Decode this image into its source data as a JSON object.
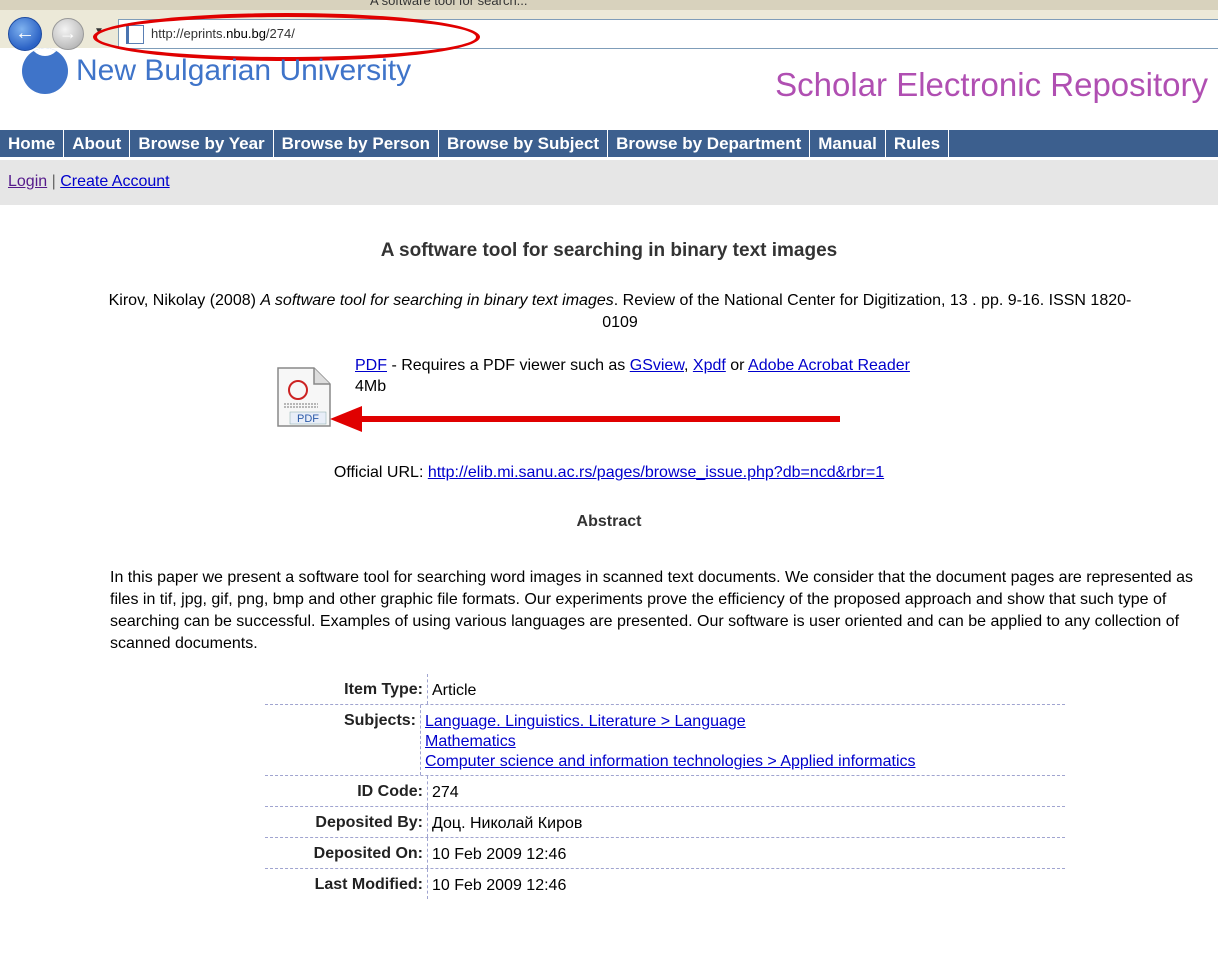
{
  "browser": {
    "url_prefix": "http://eprints.",
    "url_host": "nbu.bg",
    "url_suffix": "/274/",
    "tab_title": "A software tool for search..."
  },
  "site": {
    "university_name": "New Bulgarian University",
    "repository_name": "Scholar Electronic Repository"
  },
  "nav": [
    {
      "label": "Home"
    },
    {
      "label": "About"
    },
    {
      "label": "Browse by Year"
    },
    {
      "label": "Browse by Person"
    },
    {
      "label": "Browse by Subject"
    },
    {
      "label": "Browse by Department"
    },
    {
      "label": "Manual"
    },
    {
      "label": "Rules"
    }
  ],
  "account": {
    "login": "Login",
    "separator": "|",
    "create": "Create Account"
  },
  "article": {
    "title": "A software tool for searching in binary text images",
    "citation_author": "Kirov, Nikolay (2008)",
    "citation_title": "A software tool for searching in binary text images",
    "citation_rest": ". Review of the National Center for Digitization, 13 . pp. 9-16. ISSN 1820-0109",
    "pdf_label": "PDF",
    "pdf_requires": " - Requires a PDF viewer such as ",
    "viewer1": "GSview",
    "viewer_sep": ", ",
    "viewer2": "Xpdf",
    "viewer_or": " or ",
    "viewer3": "Adobe Acrobat Reader",
    "size": "4Mb",
    "pdf_icon_text": "PDF",
    "official_url_label": "Official URL: ",
    "official_url": "http://elib.mi.sanu.ac.rs/pages/browse_issue.php?db=ncd&rbr=1",
    "abstract_heading": "Abstract",
    "abstract": "In this paper we present a software tool for searching word images in scanned text documents. We consider that the document pages are represented as files in tif, jpg, gif, png, bmp and other graphic file formats. Our experiments prove the efficiency of the proposed approach and show that such type of searching can be successful. Examples of using various languages are presented. Our software is user oriented and can be applied to any collection of scanned documents."
  },
  "metadata": {
    "item_type_label": "Item Type:",
    "item_type": "Article",
    "subjects_label": "Subjects:",
    "subjects": [
      "Language. Linguistics. Literature > Language",
      "Mathematics",
      "Computer science and information technologies > Applied informatics"
    ],
    "id_label": "ID Code:",
    "id": "274",
    "deposited_by_label": "Deposited By:",
    "deposited_by": "Доц. Николай Киров",
    "deposited_on_label": "Deposited On:",
    "deposited_on": "10 Feb 2009 12:46",
    "modified_label": "Last Modified:",
    "modified": "10 Feb 2009 12:46"
  },
  "colors": {
    "nav_bg": "#3c5f8e",
    "brand_blue": "#3f74c9",
    "brand_purple": "#b04fb2",
    "annotation_red": "#e00000"
  }
}
